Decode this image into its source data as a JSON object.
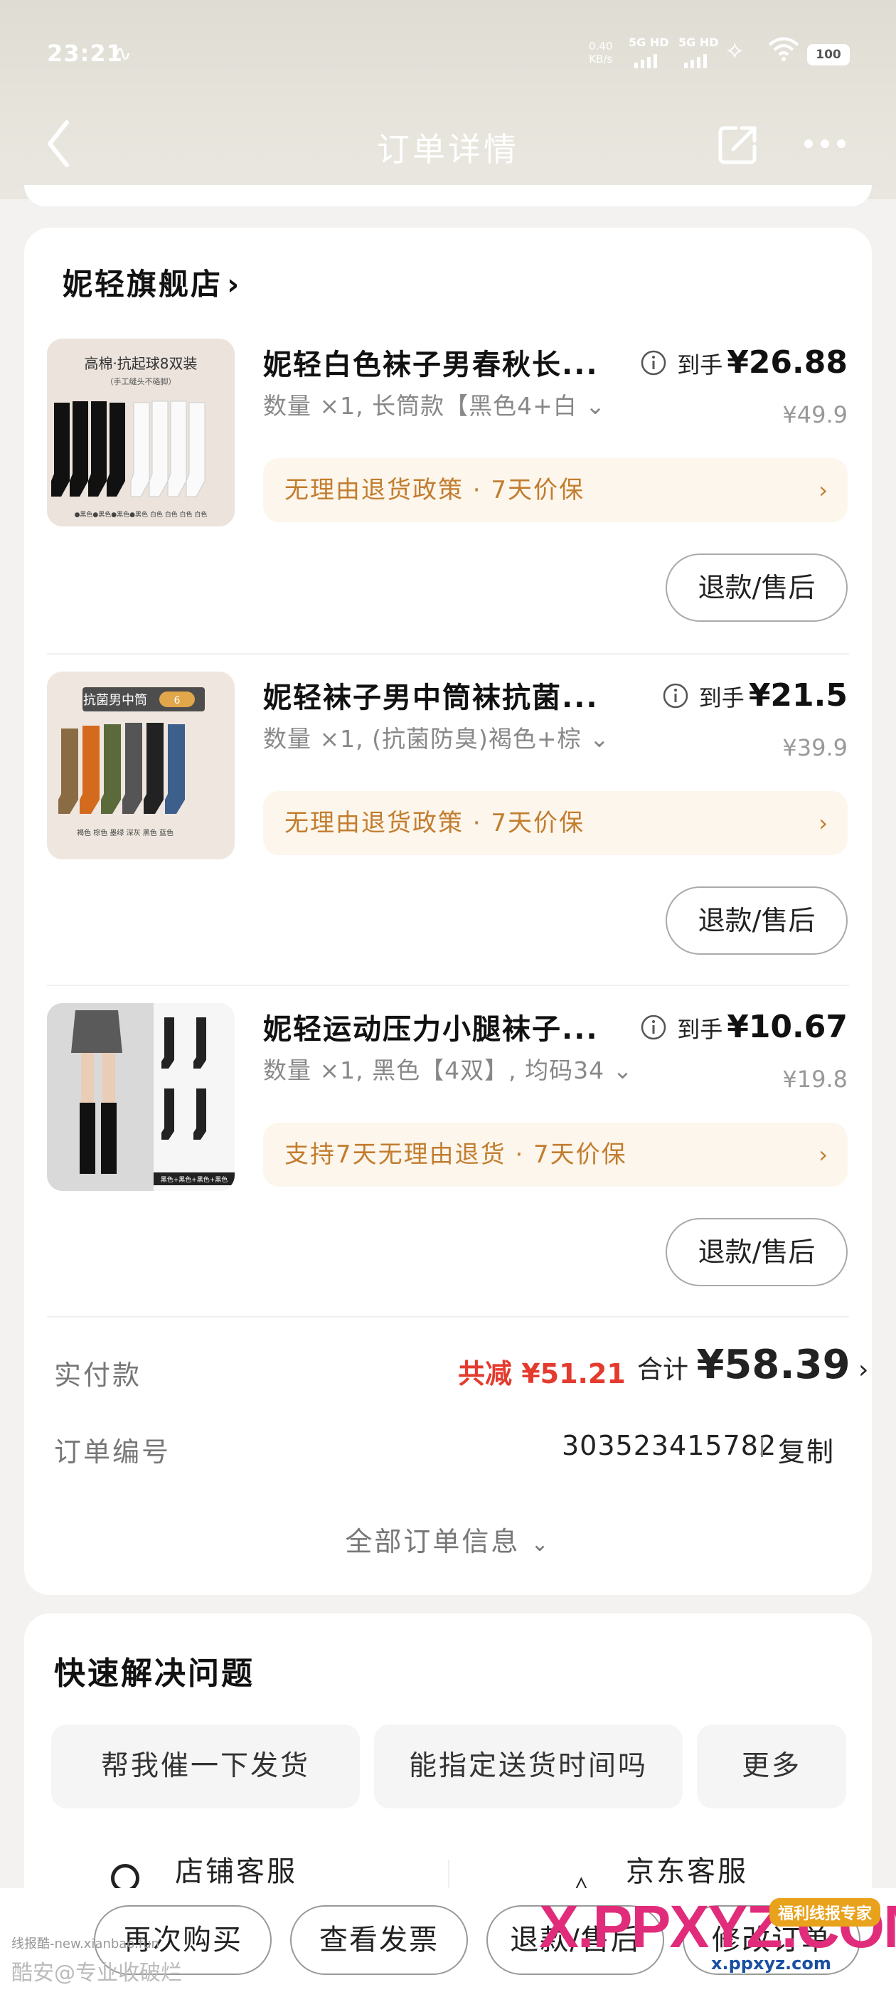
{
  "status_bar": {
    "time": "23:21",
    "speed_value": "0.40",
    "speed_unit": "KB/s",
    "net1": "5G HD",
    "net2": "5G HD",
    "battery": "100"
  },
  "nav": {
    "title": "订单详情"
  },
  "shop": {
    "name": "妮轻旗舰店",
    "chevron": "›"
  },
  "items": [
    {
      "title": "妮轻白色袜子男春秋长...",
      "spec": "数量 ×1, 长筒款【黑色4+白 ⌄",
      "price_label": "到手",
      "price": "¥26.88",
      "original_price": "¥49.9",
      "policy": "无理由退货政策 · 7天价保",
      "refund_label": "退款/售后",
      "image_header": "高棉·抗起球8双装",
      "image_sub": "（手工缝头不硌脚）",
      "image_caption": "●黑色●黑色●黑色●黑色 白色 白色 白色 白色"
    },
    {
      "title": "妮轻袜子男中筒袜抗菌...",
      "spec": "数量 ×1, (抗菌防臭)褐色+棕 ⌄",
      "price_label": "到手",
      "price": "¥21.5",
      "original_price": "¥39.9",
      "policy": "无理由退货政策 · 7天价保",
      "refund_label": "退款/售后",
      "image_header": "抗菌男中筒",
      "image_badge": "6",
      "image_caption": "褐色 棕色 墨绿 深灰 黑色 蓝色"
    },
    {
      "title": "妮轻运动压力小腿袜子...",
      "spec": "数量 ×1, 黑色【4双】, 均码34 ⌄",
      "price_label": "到手",
      "price": "¥10.67",
      "original_price": "¥19.8",
      "policy": "支持7天无理由退货 · 7天价保",
      "refund_label": "退款/售后",
      "image_caption": "黑色+黑色+黑色+黑色"
    }
  ],
  "summary": {
    "paid_label": "实付款",
    "discount": "共减 ¥51.21",
    "total_label": "合计",
    "total_value": "¥58.39",
    "order_no_label": "订单编号",
    "order_no": "303523415782",
    "copy_label": "复制",
    "all_info_label": "全部订单信息"
  },
  "quick": {
    "title": "快速解决问题",
    "chips": [
      "帮我催一下发货",
      "能指定送货时间吗",
      "更多"
    ],
    "services": [
      "店铺客服",
      "京东客服"
    ]
  },
  "bottom_bar": {
    "buttons": [
      "再次购买",
      "查看发票",
      "退款/售后",
      "修改订单"
    ]
  },
  "watermark": {
    "left_small": "线报酷-new.xianbao.fun",
    "left_big": "酷安@专业收破烂",
    "logo": "X.PPXYZ.COM",
    "tag": "福利线报专家",
    "url": "x.ppxyz.com"
  },
  "colors": {
    "accent_red": "#e43b2f",
    "policy_text": "#c27d2f",
    "policy_bg": "#fdf6ec",
    "header_bg": "#dedcd3"
  }
}
